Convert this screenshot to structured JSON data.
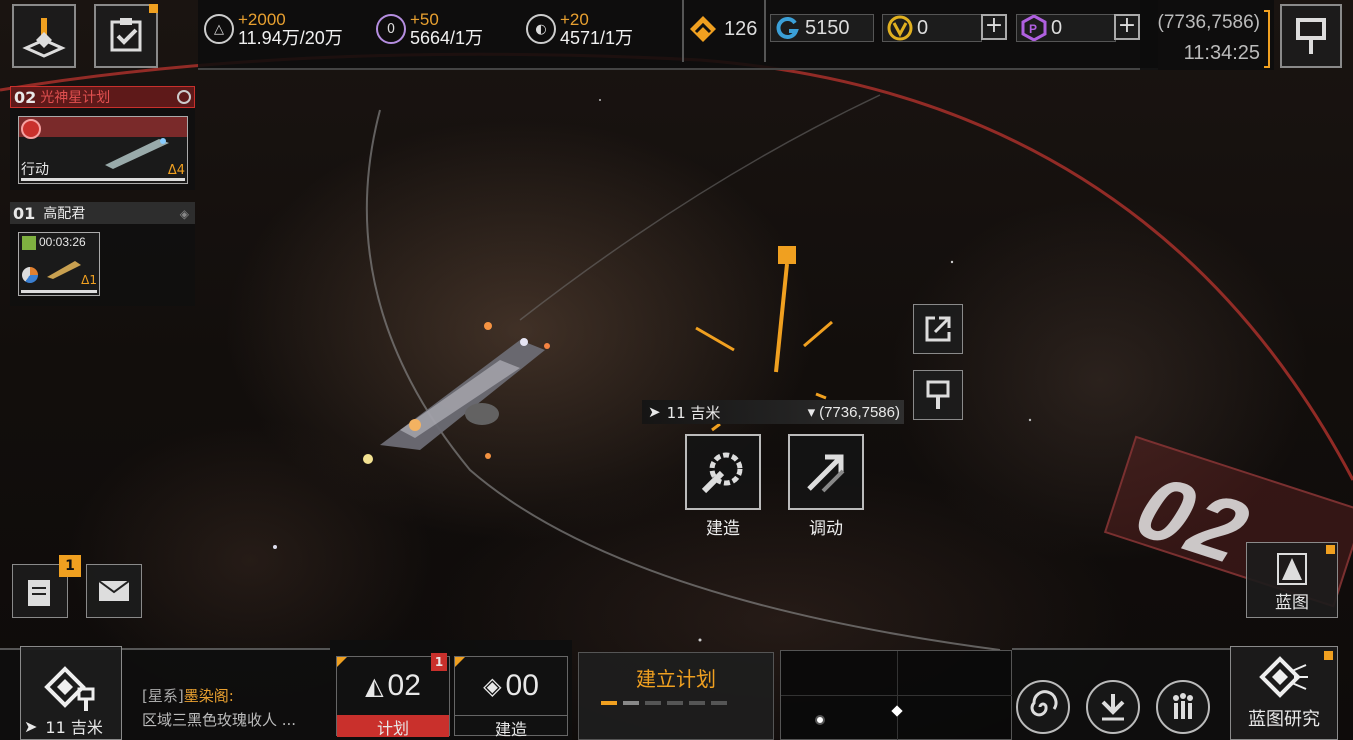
{
  "top_bar": {
    "resources": [
      {
        "icon": "triangle-resource-icon",
        "delta": "+2000",
        "value": "11.94万/20万"
      },
      {
        "icon": "zero-resource-icon",
        "delta": "+50",
        "value": "5664/1万"
      },
      {
        "icon": "crystal-resource-icon",
        "delta": "+20",
        "value": "4571/1万"
      }
    ],
    "rank_value": "126",
    "currency_g": "5150",
    "currency_v": "0",
    "currency_p": "0",
    "coords": "(7736,7586)",
    "time": "11:34:25"
  },
  "tasks": [
    {
      "num": "02",
      "title": "光神星计划",
      "status": "行动",
      "level": "Δ4",
      "color": "#c9302c"
    },
    {
      "num": "01",
      "title": "高配君",
      "timer": "00:03:26",
      "level": "Δ1"
    }
  ],
  "map": {
    "distance": "11 吉米",
    "target_coords": "(7736,7586)",
    "zone_label": "02"
  },
  "actions": {
    "build_label": "建造",
    "move_label": "调动"
  },
  "left_buttons": {
    "notes_badge": "1"
  },
  "blueprint_label": "蓝图",
  "bottom": {
    "bottom_distance": "11 吉米",
    "chat_line1_prefix": "[星系]",
    "chat_line1_name": "墨染阁:",
    "chat_line2": "区域三黑色玫瑰收人 ...",
    "plan_count": "02",
    "plan_label": "计划",
    "plan_badge": "1",
    "build_count": "00",
    "build_label": "建造",
    "create_plan": "建立计划",
    "blueprint_research": "蓝图研究"
  },
  "colors": {
    "accent_orange": "#f0a020",
    "alert_red": "#c9302c"
  }
}
